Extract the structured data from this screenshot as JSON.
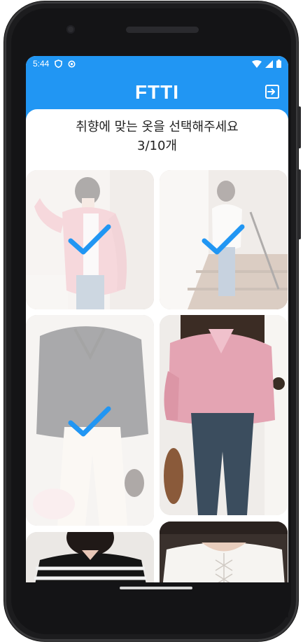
{
  "status": {
    "time": "5:44",
    "accent": "#2196f3"
  },
  "app": {
    "title": "FTTI",
    "logout_icon": "logout-icon"
  },
  "prompt": {
    "line1": "취향에 맞는 옷을 선택해주세요",
    "line2": "3/10개"
  },
  "selection": {
    "selected": 3,
    "total": 10,
    "check_color": "#2196f3"
  },
  "items": [
    {
      "id": "outfit-pink-cardigan",
      "selected": true
    },
    {
      "id": "outfit-white-blouse-stairs",
      "selected": true
    },
    {
      "id": "outfit-black-shirt-white-pants",
      "selected": true
    },
    {
      "id": "outfit-pink-shirt-jeans",
      "selected": false
    },
    {
      "id": "outfit-striped-knit",
      "selected": false
    },
    {
      "id": "outfit-white-lace-blouse",
      "selected": false
    }
  ]
}
